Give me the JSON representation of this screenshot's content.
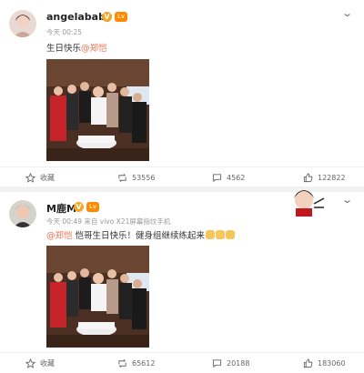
{
  "post1": {
    "username": "angelababy",
    "verified_badge": "V",
    "level_badge": "Lv",
    "time": "今天 00:25",
    "text_prefix": "生日快乐",
    "mention": "@郑恺",
    "actions": {
      "favorite_label": "收藏",
      "repost_count": "53556",
      "comment_count": "4562",
      "like_count": "122822"
    }
  },
  "post2": {
    "username": "M鹿M",
    "verified_badge": "V",
    "level_badge": "Lv",
    "time": "今天 00:49",
    "source": "来自 vivo X21屏幕指纹手机",
    "mention": "@郑恺",
    "text_suffix": " 恺哥生日快乐！健身组继续练起来",
    "actions": {
      "favorite_label": "收藏",
      "repost_count": "65612",
      "comment_count": "20188",
      "like_count": "183060"
    }
  },
  "colors": {
    "mention": "#eb7350",
    "verified": "#f6a623",
    "divider": "#f2f2f2"
  }
}
